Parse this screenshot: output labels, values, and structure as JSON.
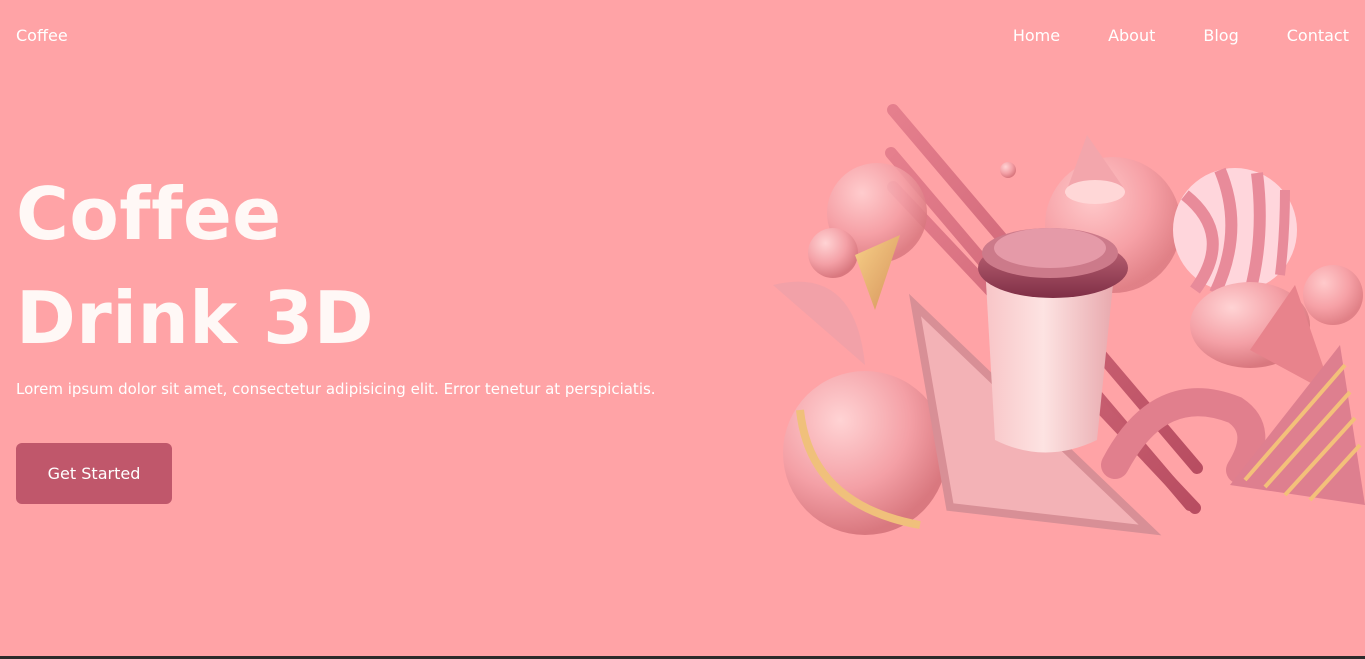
{
  "header": {
    "logo": "Coffee",
    "menu": [
      {
        "label": "Home"
      },
      {
        "label": "About"
      },
      {
        "label": "Blog"
      },
      {
        "label": "Contact"
      }
    ]
  },
  "hero": {
    "title_line1": "Coffee",
    "title_line2": "Drink 3D",
    "description": "Lorem ipsum dolor sit amet, consectetur adipisicing elit. Error tenetur at perspiciatis.",
    "cta_label": "Get Started"
  },
  "colors": {
    "background": "#ffa3a6",
    "button": "#c0576b",
    "text": "#ffffff"
  },
  "illustration": {
    "icon": "coffee-cup-3d-illustration"
  }
}
